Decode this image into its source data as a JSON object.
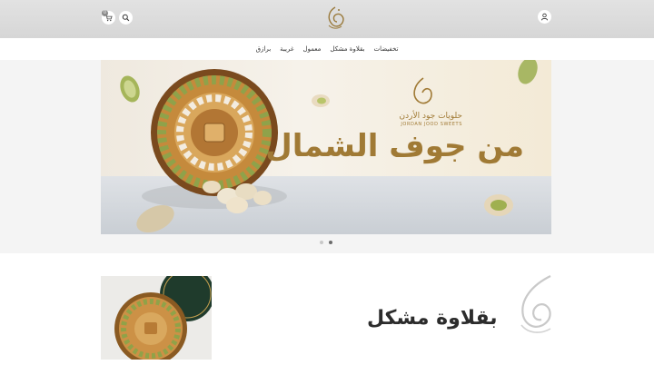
{
  "header": {
    "logo_icon": "calligraphy-logo-icon",
    "cart_count": "0",
    "search_icon": "search-icon",
    "cart_icon": "cart-icon",
    "user_icon": "user-icon"
  },
  "nav": {
    "items": [
      {
        "label": "تخفيضات"
      },
      {
        "label": "بقلاوة مشكل"
      },
      {
        "label": "معمول"
      },
      {
        "label": "غريبة"
      },
      {
        "label": "برازق"
      }
    ]
  },
  "hero": {
    "brand_ar": "حلويات جود الأردن",
    "brand_en": "JORDAN JOOD SWEETS",
    "title": "من جوف الشمال",
    "slide_count": 2,
    "active_slide": 2
  },
  "featured": {
    "title": "بقلاوة مشكل"
  },
  "colors": {
    "gold": "#a07a35",
    "header_bg": "#dcdcdc"
  }
}
